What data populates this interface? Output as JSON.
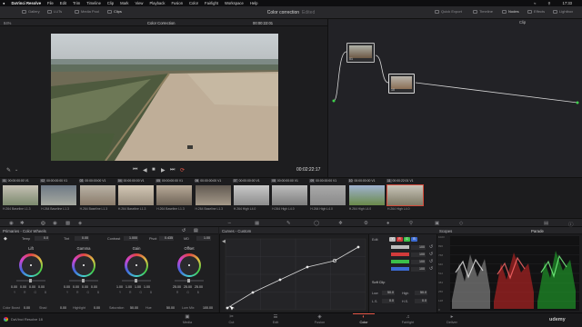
{
  "menubar": {
    "app": "DaVinci Resolve",
    "items": [
      "File",
      "Edit",
      "Trim",
      "Timeline",
      "Clip",
      "Mark",
      "View",
      "Playback",
      "Fusion",
      "Color",
      "Fairlight",
      "Workspace",
      "Help"
    ],
    "clock": "17:33"
  },
  "toolbar": {
    "left": [
      "Gallery",
      "LUTs",
      "Media Pool",
      "Clips"
    ],
    "project_title": "Color correction",
    "edited": "Edited",
    "right": [
      "Quick Export",
      "Timeline",
      "Nodes",
      "Effects",
      "Lightbox"
    ]
  },
  "viewer": {
    "zoom": "84%",
    "name": "Color Correction",
    "timecode_top": "00:00:22:01",
    "timecode_bottom": "00:02:22:17"
  },
  "nodes": {
    "label": "Clip",
    "node1": "01",
    "node2": "10"
  },
  "clips": [
    {
      "num": "01",
      "tc": "00:00:00:00",
      "track": "V1",
      "name": "H.264 Baseline L1.3",
      "thumb": [
        "#c5c0b4",
        "#7c8a6e"
      ]
    },
    {
      "num": "02",
      "tc": "00:00:00:00",
      "track": "V1",
      "name": "H.264 Baseline L1.3",
      "thumb": [
        "#6f7a86",
        "#a6a9a0"
      ]
    },
    {
      "num": "03",
      "tc": "00:00:00:00",
      "track": "V1",
      "name": "H.264 Baseline L1.3",
      "thumb": [
        "#b9b2a6",
        "#8a7b6a"
      ]
    },
    {
      "num": "04",
      "tc": "00:00:00:00",
      "track": "V1",
      "name": "H.264 Baseline L1.3",
      "thumb": [
        "#d2c7b5",
        "#9a8e7e"
      ]
    },
    {
      "num": "05",
      "tc": "00:00:00:00",
      "track": "V1",
      "name": "H.264 Baseline L1.3",
      "thumb": [
        "#b8aa98",
        "#6e6356"
      ]
    },
    {
      "num": "06",
      "tc": "00:00:00:00",
      "track": "V1",
      "name": "H.264 Baseline L1.3",
      "thumb": [
        "#625a52",
        "#a49888"
      ]
    },
    {
      "num": "07",
      "tc": "00:00:00:00",
      "track": "V1",
      "name": "H.264 High L4.0",
      "thumb": [
        "#c9c9c9",
        "#8c8c8c"
      ]
    },
    {
      "num": "08",
      "tc": "00:00:00:00",
      "track": "V1",
      "name": "H.264 High L4.0",
      "thumb": [
        "#bdbdbd",
        "#7d7d7d"
      ]
    },
    {
      "num": "09",
      "tc": "00:00:00:00",
      "track": "V1",
      "name": "H.264 High L4.0",
      "thumb": [
        "#a9a9a9",
        "#8a8a8a"
      ]
    },
    {
      "num": "10",
      "tc": "00:00:00:00",
      "track": "V1",
      "name": "H.264 High L4.0",
      "thumb": [
        "#9fb2d0",
        "#6a8a4a"
      ]
    },
    {
      "num": "11",
      "tc": "00:00:22:01",
      "track": "V1",
      "name": "H.264 High L4.0",
      "thumb": [
        "#c8c4b8",
        "#7e7a66"
      ]
    }
  ],
  "wheels": {
    "title": "Primaries - Color Wheels",
    "temp_label": "Temp",
    "temp": "0.0",
    "tint_label": "Tint",
    "tint": "0.00",
    "contrast_label": "Contrast",
    "contrast": "1.000",
    "pivot_label": "Pivot",
    "pivot": "0.435",
    "md_label": "MD",
    "md": "1.00",
    "items": [
      {
        "name": "Lift",
        "vals": [
          "0.00",
          "0.00",
          "0.00",
          "0.00"
        ]
      },
      {
        "name": "Gamma",
        "vals": [
          "0.00",
          "0.00",
          "0.00",
          "0.00"
        ]
      },
      {
        "name": "Gain",
        "vals": [
          "1.00",
          "1.00",
          "1.00",
          "1.00"
        ]
      },
      {
        "name": "Offset",
        "vals": [
          "25.00",
          "25.00",
          "25.00"
        ]
      }
    ],
    "channels": [
      "Y",
      "R",
      "G",
      "B"
    ],
    "offset_channels": [
      "R",
      "G",
      "B"
    ],
    "params": [
      {
        "label": "Color Boost",
        "value": "0.00"
      },
      {
        "label": "Shad",
        "value": "0.00"
      },
      {
        "label": "Highlight",
        "value": "0.00"
      },
      {
        "label": "Saturation",
        "value": "50.00"
      },
      {
        "label": "Hue",
        "value": "50.00"
      },
      {
        "label": "Lum Mix",
        "value": "100.00"
      }
    ]
  },
  "curves": {
    "title": "Curves - Custom",
    "edit_label": "Edit",
    "channels": [
      {
        "name": "Y",
        "color": "#bdbdbd"
      },
      {
        "name": "R",
        "color": "#d23b3b"
      },
      {
        "name": "G",
        "color": "#3bbf4a"
      },
      {
        "name": "B",
        "color": "#3b6ad2"
      }
    ],
    "values": [
      "100",
      "100",
      "100",
      "100"
    ],
    "soft_clip": "Soft Clip",
    "low_label": "Low",
    "low": "50.0",
    "high_label": "High",
    "high": "50.0",
    "ls_label": "L.S.",
    "ls": "0.0",
    "hs_label": "H.S.",
    "hs": "0.0"
  },
  "scopes": {
    "title": "Scopes",
    "mode": "Parade",
    "scale": [
      "1023",
      "896",
      "768",
      "640",
      "512",
      "384",
      "256",
      "128",
      "0"
    ]
  },
  "pages": [
    {
      "label": "Media",
      "icon": "▣",
      "active": false
    },
    {
      "label": "Cut",
      "icon": "✂",
      "active": false
    },
    {
      "label": "Edit",
      "icon": "☰",
      "active": false
    },
    {
      "label": "Fusion",
      "icon": "◈",
      "active": false
    },
    {
      "label": "Color",
      "icon": "◐",
      "active": true
    },
    {
      "label": "Fairlight",
      "icon": "♫",
      "active": false
    },
    {
      "label": "Deliver",
      "icon": "▸",
      "active": false
    }
  ],
  "brand": "DaVinci Resolve 18",
  "watermark": "udemy"
}
